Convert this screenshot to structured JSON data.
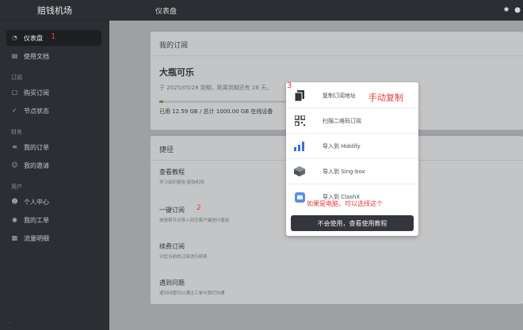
{
  "brand": "赔钱机场",
  "header": {
    "title": "仪表盘"
  },
  "sidebar": {
    "items": [
      {
        "label": "仪表盘",
        "icon": "dashboard-icon"
      },
      {
        "label": "使用文档",
        "icon": "book-icon"
      }
    ],
    "groups": [
      {
        "title": "订阅",
        "items": [
          {
            "label": "购买订阅"
          },
          {
            "label": "节点状态"
          }
        ]
      },
      {
        "title": "财务",
        "items": [
          {
            "label": "我的订单"
          },
          {
            "label": "我的邀请"
          }
        ]
      },
      {
        "title": "用户",
        "items": [
          {
            "label": "个人中心"
          },
          {
            "label": "我的工单"
          },
          {
            "label": "流量明细"
          }
        ]
      }
    ]
  },
  "subscription": {
    "section_title": "我的订阅",
    "plan_name": "大瓶可乐",
    "expiry_text": "于 2025/05/28 到期，距离到期还有 28 天。",
    "usage_text": "已用 12.59 GB / 总计 1000.00 GB 在线设备",
    "usage_fraction": 0.0126
  },
  "shortcuts": {
    "section_title": "捷径",
    "items": [
      {
        "title": "查看教程",
        "desc": "学习如何使用 赔钱机场"
      },
      {
        "title": "一键订阅",
        "desc": "快速将节点导入对应客户端进行使用"
      },
      {
        "title": "续费订阅",
        "desc": "对您当前的订阅进行续费"
      },
      {
        "title": "遇到问题",
        "desc": "遇到问题可以通过工单与我们沟通"
      }
    ]
  },
  "popup": {
    "items": [
      {
        "label": "复制订阅地址",
        "icon": "copy-icon"
      },
      {
        "label": "扫描二维码订阅",
        "icon": "qrcode-icon"
      },
      {
        "label": "导入到 Hiddify",
        "icon": "hiddify-icon"
      },
      {
        "label": "导入到 Sing-box",
        "icon": "singbox-icon"
      },
      {
        "label": "导入到 ClashX",
        "icon": "clashx-icon"
      }
    ],
    "button": "不会使用，查看使用教程"
  },
  "annotations": {
    "one": "1",
    "two": "2",
    "three": "3",
    "manual_copy": "手动复制",
    "pc_hint": "如果是电脑，可以选择这个"
  }
}
